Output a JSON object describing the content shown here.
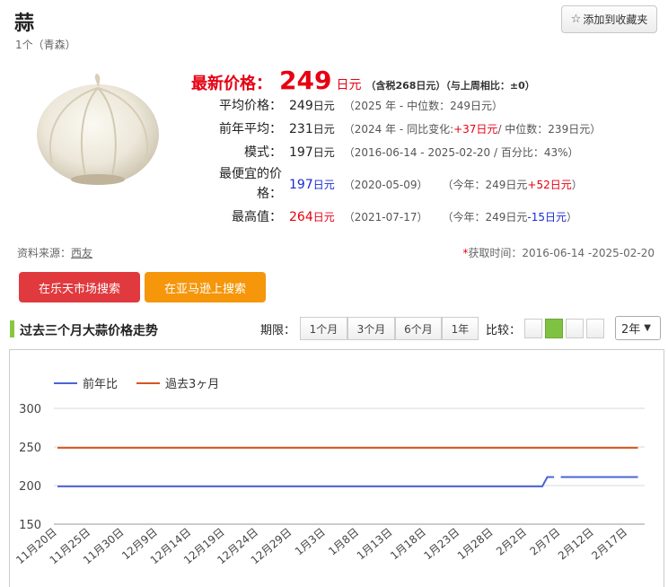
{
  "product": {
    "title": "蒜",
    "subtitle": "1个（青森）"
  },
  "favorite": {
    "icon": "star-outline-icon",
    "label": "添加到收藏夹"
  },
  "latest": {
    "label": "最新价格：",
    "value": "249",
    "unit": "日元",
    "note": "（含税268日元）（与上周相比：±0）"
  },
  "avg": {
    "label": "平均价格：",
    "value": "249",
    "unit": "日元",
    "note": "（2025 年 - 中位数：249日元）"
  },
  "prev": {
    "label": "前年平均：",
    "value": "231",
    "unit": "日元",
    "note_a": "（2024 年 - 同比变化:",
    "change": "+37日元",
    "note_b": "/ 中位数：239日元）"
  },
  "mode": {
    "label": "模式：",
    "value": "197",
    "unit": "日元",
    "note": "（2016-06-14 - 2025-02-20 / 百分比：43%）"
  },
  "cheapest": {
    "label_1": "最便宜的价",
    "label_2": "格：",
    "value": "197",
    "unit": "日元",
    "date": "（2020-05-09）",
    "cmp_a": "（今年：249日元",
    "change": "+52日元",
    "cmp_b": "）"
  },
  "highest": {
    "label": "最高值：",
    "value": "264",
    "unit": "日元",
    "date": "（2021-07-17）",
    "cmp_a": "（今年：249日元",
    "change": "-15日元",
    "cmp_b": "）"
  },
  "source": {
    "label": "资料来源：",
    "link": "西友"
  },
  "fetch": {
    "mark": "*",
    "label": "获取时间：2016-06-14 -2025-02-20"
  },
  "buttons": {
    "rakuten": "在乐天市场搜索",
    "amazon": "在亚马逊上搜索"
  },
  "section": {
    "title": "过去三个月大蒜价格走势"
  },
  "period": {
    "label": "期限：",
    "options": [
      "1个月",
      "3个月",
      "6个月",
      "1年"
    ]
  },
  "compare": {
    "label": "比较：",
    "selected_index": 1
  },
  "range_select": {
    "value": "2年"
  },
  "colors": {
    "red": "#e60012",
    "blue": "#1a2bd6",
    "green": "#8cc63f",
    "rakuten": "#e03a3e",
    "amazon": "#f5960b",
    "line_prev_year": "#4a64d4",
    "line_past3m": "#d9541e"
  },
  "chart_data": {
    "type": "line",
    "title": "",
    "ylim": [
      150,
      300
    ],
    "yticks": [
      150,
      200,
      250,
      300
    ],
    "x_labels": [
      "11月20日",
      "11月25日",
      "11月30日",
      "12月9日",
      "12月14日",
      "12月19日",
      "12月24日",
      "12月29日",
      "1月3日",
      "1月8日",
      "1月13日",
      "1月18日",
      "1月23日",
      "1月28日",
      "2月2日",
      "2月7日",
      "2月12日",
      "2月17日"
    ],
    "legend_position": "top-left",
    "grid": true,
    "series": [
      {
        "name": "前年比",
        "color": "#4a64d4",
        "points": [
          [
            0,
            199
          ],
          [
            14.45,
            199
          ],
          [
            14.6,
            211
          ],
          [
            14.8,
            211
          ]
        ],
        "points_b": [
          [
            15.0,
            211
          ],
          [
            17.3,
            211
          ]
        ]
      },
      {
        "name": "過去3ヶ月",
        "color": "#d9541e",
        "points": [
          [
            0,
            249
          ],
          [
            17.3,
            249
          ]
        ]
      }
    ]
  }
}
